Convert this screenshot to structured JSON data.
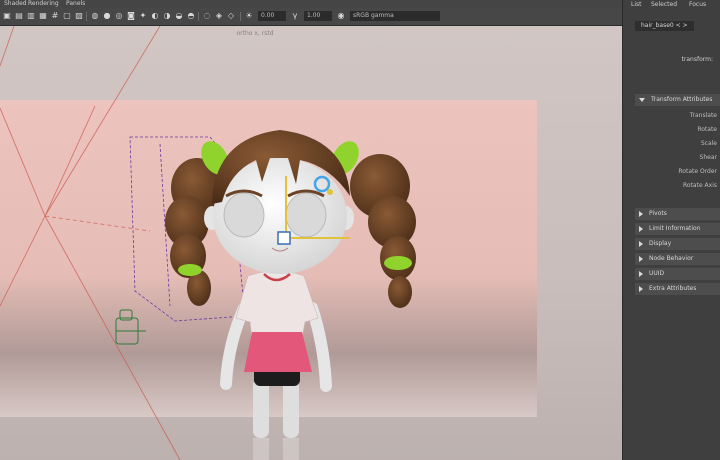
{
  "menu": [
    "Shaded",
    "Rendering",
    "Panels"
  ],
  "toolbar": {
    "field1": "0.00",
    "field2": "1.00",
    "colorspace": "sRGB gamma"
  },
  "viewport": {
    "camera_label": "ortho x, rstd"
  },
  "panel": {
    "tabs": [
      "List",
      "Selected",
      "Focus"
    ],
    "node_tab": "hair_base0 < >",
    "node_type": "transform:",
    "sections": [
      {
        "label": "Transform Attributes",
        "open": true
      },
      {
        "label": "Pivots",
        "open": false
      },
      {
        "label": "Limit Information",
        "open": false
      },
      {
        "label": "Display",
        "open": false
      },
      {
        "label": "Node Behavior",
        "open": false
      },
      {
        "label": "UUID",
        "open": false
      },
      {
        "label": "Extra Attributes",
        "open": false
      }
    ],
    "transform_attrs": [
      "Translate",
      "Rotate",
      "Scale",
      "Shear",
      "Rotate Order",
      "Rotate Axis"
    ]
  },
  "colors": {
    "backdrop": "#ecc2bc",
    "hair": "#6b4326",
    "skin": "#eeeeee",
    "skirt": "#e2577a",
    "clips": "#8fd32c",
    "collar": "#c8414b"
  }
}
